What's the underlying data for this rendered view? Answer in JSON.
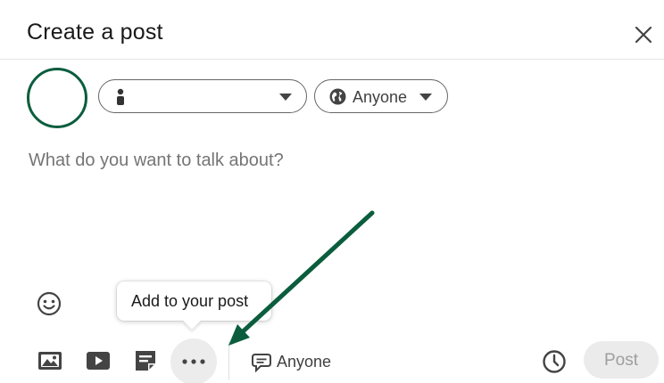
{
  "dialog": {
    "title": "Create a post"
  },
  "identity": {
    "name": ""
  },
  "audience": {
    "label": "Anyone"
  },
  "composer": {
    "placeholder": "What do you want to talk about?"
  },
  "tooltip": {
    "text": "Add to your post"
  },
  "toolbar": {
    "comment_audience_label": "Anyone",
    "post_label": "Post"
  },
  "icons": {
    "close": "close-icon",
    "person": "person-icon",
    "globe": "globe-icon",
    "emoji": "emoji-icon",
    "photo": "photo-icon",
    "video": "video-icon",
    "document": "document-icon",
    "more": "more-icon",
    "comment": "comment-icon",
    "schedule": "clock-icon"
  },
  "colors": {
    "avatar_ring": "#0b5d3d",
    "annotation_arrow": "#0b5d3d",
    "post_disabled_bg": "#ebebeb",
    "post_disabled_text": "#9e9e9e"
  }
}
